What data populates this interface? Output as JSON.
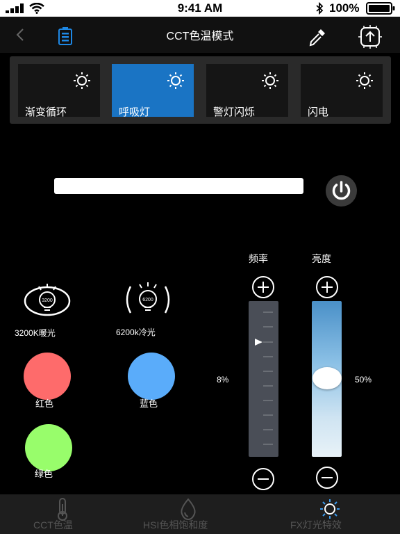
{
  "status_bar": {
    "time": "9:41 AM",
    "battery_percent": "100%",
    "icons": [
      "signal-icon",
      "wifi-icon",
      "bluetooth-icon",
      "battery-icon"
    ]
  },
  "nav": {
    "title": "CCT色温模式",
    "icons": [
      "back-icon",
      "device-battery-icon",
      "eyedropper-icon",
      "upload-icon"
    ]
  },
  "effects": [
    {
      "label": "渐变循环",
      "icon": "sun-icon",
      "active": false
    },
    {
      "label": "呼吸灯",
      "icon": "sun-icon",
      "active": true
    },
    {
      "label": "警灯闪烁",
      "icon": "sun-icon",
      "active": false
    },
    {
      "label": "闪电",
      "icon": "sun-icon",
      "active": false
    }
  ],
  "presets": {
    "warm": {
      "label": "3200K暖光",
      "bulb_text": "3200"
    },
    "cool": {
      "label": "6200k冷光",
      "bulb_text": "6200"
    },
    "red": {
      "label": "红色",
      "color": "#fe6b6b"
    },
    "blue": {
      "label": "蓝色",
      "color": "#5aacfa"
    },
    "green": {
      "label": "绿色",
      "color": "#98fd6b"
    }
  },
  "frequency": {
    "label": "频率",
    "value_text": "8%",
    "value": 0.08
  },
  "brightness": {
    "label": "亮度",
    "value_text": "50%",
    "value": 0.5
  },
  "tabs": [
    {
      "label": "CCT色温",
      "icon": "thermometer-icon"
    },
    {
      "label": "HSI色相饱和度",
      "icon": "drop-icon"
    },
    {
      "label": "FX灯光特效",
      "icon": "sun-icon"
    }
  ],
  "colors": {
    "accent": "#1a74c4",
    "background": "#000000",
    "panel": "#2a2a2a"
  }
}
